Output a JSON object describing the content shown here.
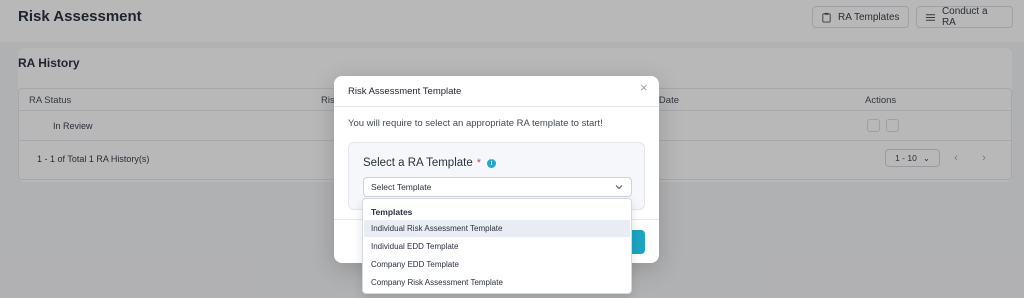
{
  "header": {
    "title": "Risk Assessment",
    "templates_btn": "RA Templates",
    "conduct_btn": "Conduct a RA"
  },
  "history": {
    "title": "RA History",
    "columns": [
      "RA Status",
      "Ris",
      "d Date",
      "Actions"
    ],
    "rows": [
      {
        "status": "In Review"
      }
    ],
    "footer_text": "1 - 1 of Total 1 RA History(s)",
    "page_size": "1 - 10"
  },
  "modal": {
    "title": "Risk Assessment Template",
    "close_glyph": "×",
    "description": "You will require to select an appropriate RA template to start!",
    "select_label": "Select a RA Template",
    "required_mark": "*",
    "info_glyph": "i",
    "select_placeholder": "Select Template"
  },
  "dropdown": {
    "group_label": "Templates",
    "options": [
      "Individual Risk Assessment Template",
      "Individual EDD Template",
      "Company EDD Template",
      "Company Risk Assessment Template"
    ],
    "active_index": 0
  },
  "colors": {
    "accent": "#1aa5c2",
    "required": "#e0463f",
    "overlay": "rgba(40,40,40,0.33)"
  }
}
